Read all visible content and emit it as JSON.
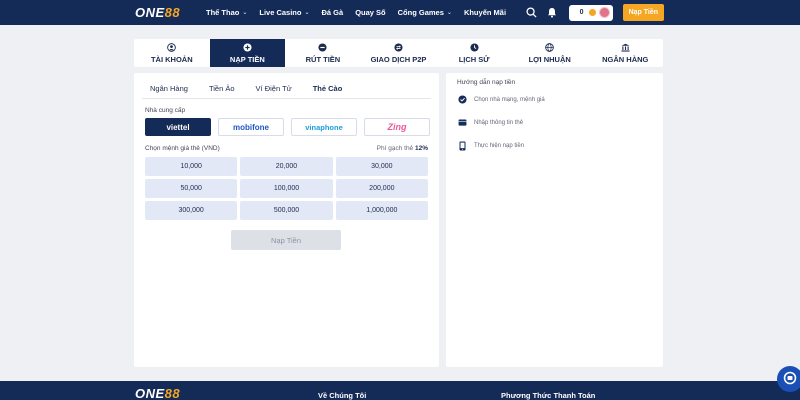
{
  "header": {
    "logo_main": "ONE",
    "logo_accent": "88",
    "nav": [
      {
        "label": "Thể Thao",
        "has_dropdown": true
      },
      {
        "label": "Live Casino",
        "has_dropdown": true
      },
      {
        "label": "Đá Gà",
        "has_dropdown": false
      },
      {
        "label": "Quay Số",
        "has_dropdown": false
      },
      {
        "label": "Cổng Games",
        "has_dropdown": true
      },
      {
        "label": "Khuyến Mãi",
        "has_dropdown": false
      }
    ],
    "balance": "0",
    "deposit_button": "Nạp Tiền",
    "icons": [
      "search-icon",
      "bell-icon",
      "coin-icon",
      "avatar"
    ]
  },
  "tabs": [
    {
      "label": "TÀI KHOẢN",
      "icon": "user-icon",
      "active": false
    },
    {
      "label": "NẠP TIỀN",
      "icon": "plus-circle-icon",
      "active": true
    },
    {
      "label": "RÚT TIỀN",
      "icon": "minus-circle-icon",
      "active": false
    },
    {
      "label": "GIAO DỊCH P2P",
      "icon": "exchange-icon",
      "active": false
    },
    {
      "label": "LỊCH SỬ",
      "icon": "clock-icon",
      "active": false
    },
    {
      "label": "LỢI NHUẬN",
      "icon": "globe-icon",
      "active": false
    },
    {
      "label": "NGÂN HÀNG",
      "icon": "bank-icon",
      "active": false
    }
  ],
  "deposit": {
    "subtabs": [
      {
        "label": "Ngân Hàng",
        "active": false
      },
      {
        "label": "Tiền Ảo",
        "active": false
      },
      {
        "label": "Ví Điện Tử",
        "active": false
      },
      {
        "label": "Thẻ Cào",
        "active": true
      }
    ],
    "provider_label": "Nhà cung cấp",
    "providers": [
      {
        "label": "viettel",
        "selected": true
      },
      {
        "label": "mobifone",
        "selected": false
      },
      {
        "label": "vinaphone",
        "selected": false
      },
      {
        "label": "Zing",
        "selected": false
      }
    ],
    "denomination_label": "Chọn mệnh giá thẻ (VND)",
    "fee_label": "Phí gạch thẻ",
    "fee_value": "12%",
    "denominations": [
      "10,000",
      "20,000",
      "30,000",
      "50,000",
      "100,000",
      "200,000",
      "300,000",
      "500,000",
      "1,000,000"
    ],
    "submit_label": "Nạp Tiền"
  },
  "guide": {
    "title": "Hướng dẫn nạp tiền",
    "steps": [
      {
        "label": "Chọn nhà mạng, mệnh giá",
        "icon": "check-circle-icon"
      },
      {
        "label": "Nhập thông tin thẻ",
        "icon": "card-icon"
      },
      {
        "label": "Thực hiện nạp tiền",
        "icon": "phone-icon"
      }
    ]
  },
  "footer": {
    "logo_main": "ONE",
    "logo_accent": "88",
    "about_label": "Về Chúng Tôi",
    "payment_label": "Phương Thức Thanh Toán"
  },
  "colors": {
    "navy": "#142a57",
    "accent": "#f5a623",
    "denom_bg": "#e3e8f6"
  }
}
